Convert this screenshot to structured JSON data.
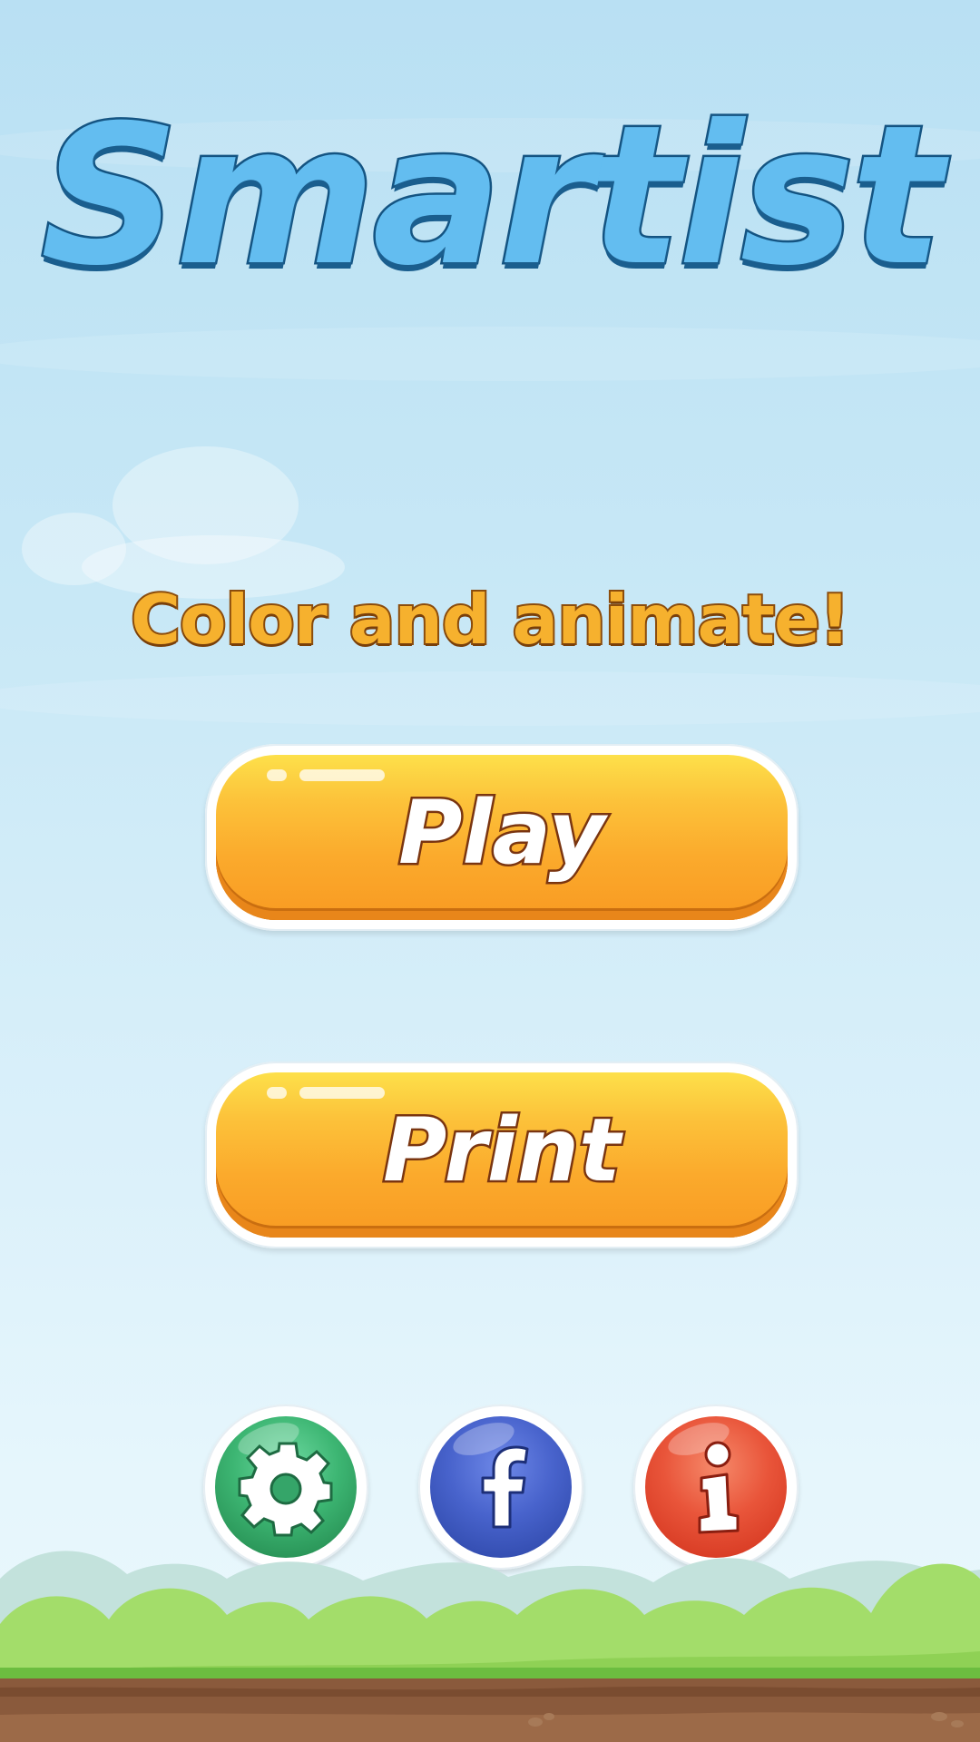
{
  "app": {
    "title": "Smartist",
    "tagline": "Color and animate!"
  },
  "menu": {
    "play_label": "Play",
    "print_label": "Print"
  },
  "icons": {
    "settings": "gear-icon",
    "facebook": "facebook-icon",
    "info": "info-icon"
  },
  "colors": {
    "title_fill": "#63bdf0",
    "tagline_fill": "#f6b12e",
    "button_orange": "#fbaa2c",
    "settings_green": "#35a569",
    "facebook_blue": "#3f58c0",
    "info_red": "#e5472f"
  }
}
